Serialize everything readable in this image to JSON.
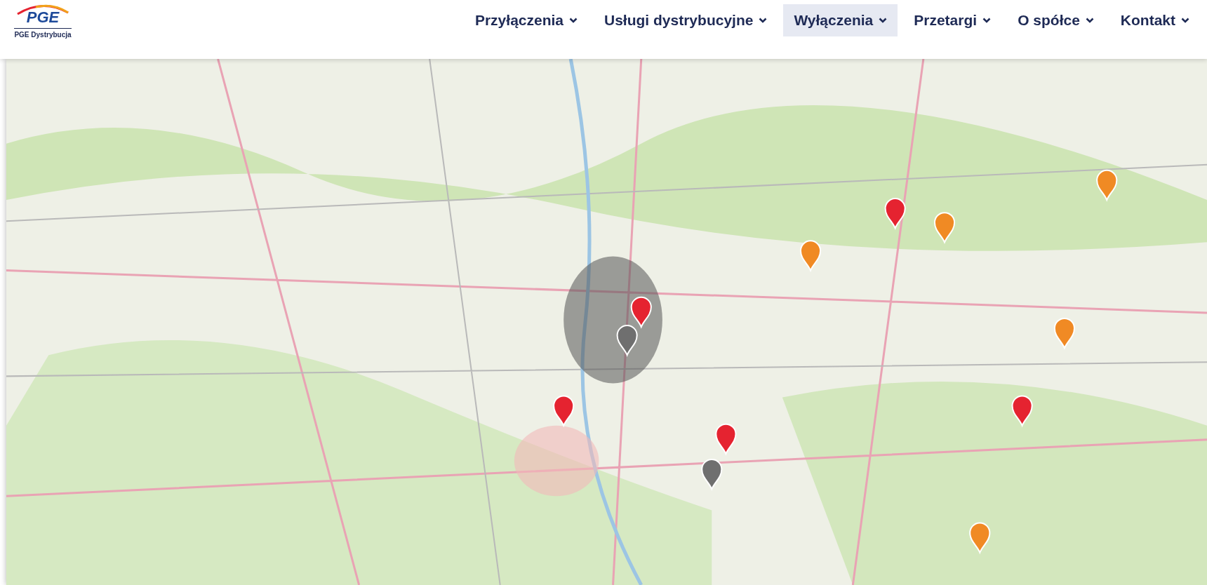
{
  "logo": {
    "brand": "PGE",
    "name": "PGE Dystrybucja"
  },
  "nav": [
    {
      "label": "Przyłączenia",
      "selected": false
    },
    {
      "label": "Usługi dystrybucyjne",
      "selected": false
    },
    {
      "label": "Wyłączenia",
      "selected": true
    },
    {
      "label": "Przetargi",
      "selected": false
    },
    {
      "label": "O spółce",
      "selected": false
    },
    {
      "label": "Kontakt",
      "selected": false
    }
  ]
}
